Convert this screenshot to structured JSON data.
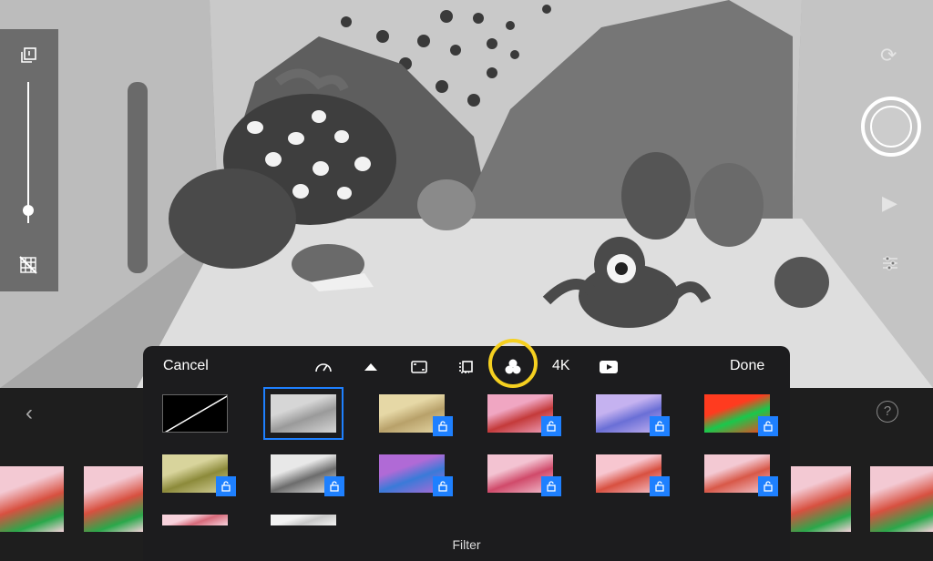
{
  "toolbar": {
    "cancel_label": "Cancel",
    "done_label": "Done",
    "resolution_label": "4K"
  },
  "sheet": {
    "title": "Filter"
  },
  "help": {
    "label": "?"
  },
  "colors": {
    "accent": "#1e80ff",
    "highlight": "#f5d020",
    "sheet_bg": "#1c1c1e"
  },
  "filters": [
    {
      "name": "none",
      "locked": false,
      "selected": false,
      "palette": [
        "#000000",
        "#ffffff"
      ]
    },
    {
      "name": "mono",
      "locked": false,
      "selected": true,
      "palette": [
        "#9a9a9a",
        "#d6d6d6"
      ]
    },
    {
      "name": "sepia",
      "locked": true,
      "selected": false,
      "palette": [
        "#b8a16a",
        "#e6d8a6"
      ]
    },
    {
      "name": "vivid",
      "locked": true,
      "selected": false,
      "palette": [
        "#c43a3a",
        "#f0a6c2"
      ]
    },
    {
      "name": "cool",
      "locked": true,
      "selected": false,
      "palette": [
        "#6a6fd6",
        "#c5b2f0"
      ]
    },
    {
      "name": "thermal",
      "locked": true,
      "selected": false,
      "palette": [
        "#19c84c",
        "#ff3b1f"
      ]
    },
    {
      "name": "olive",
      "locked": true,
      "selected": false,
      "palette": [
        "#8c8a3a",
        "#d8d49c"
      ]
    },
    {
      "name": "silver",
      "locked": true,
      "selected": false,
      "palette": [
        "#6c6c6c",
        "#e8e8e8"
      ]
    },
    {
      "name": "pop",
      "locked": true,
      "selected": false,
      "palette": [
        "#3a7ad8",
        "#b06ad6"
      ]
    },
    {
      "name": "warm",
      "locked": true,
      "selected": false,
      "palette": [
        "#d04a6a",
        "#f3c3d2"
      ]
    },
    {
      "name": "fade",
      "locked": true,
      "selected": false,
      "palette": [
        "#d85040",
        "#f7c6d0"
      ]
    },
    {
      "name": "rose",
      "locked": true,
      "selected": false,
      "palette": [
        "#d85848",
        "#f3c9d3"
      ]
    },
    {
      "name": "row3a",
      "locked": false,
      "selected": false,
      "palette": [
        "#d66a7a",
        "#f7d2dc"
      ]
    },
    {
      "name": "row3b",
      "locked": false,
      "selected": false,
      "palette": [
        "#c8c8c8",
        "#f2f2f2"
      ]
    }
  ],
  "exposure_level": 0.91
}
